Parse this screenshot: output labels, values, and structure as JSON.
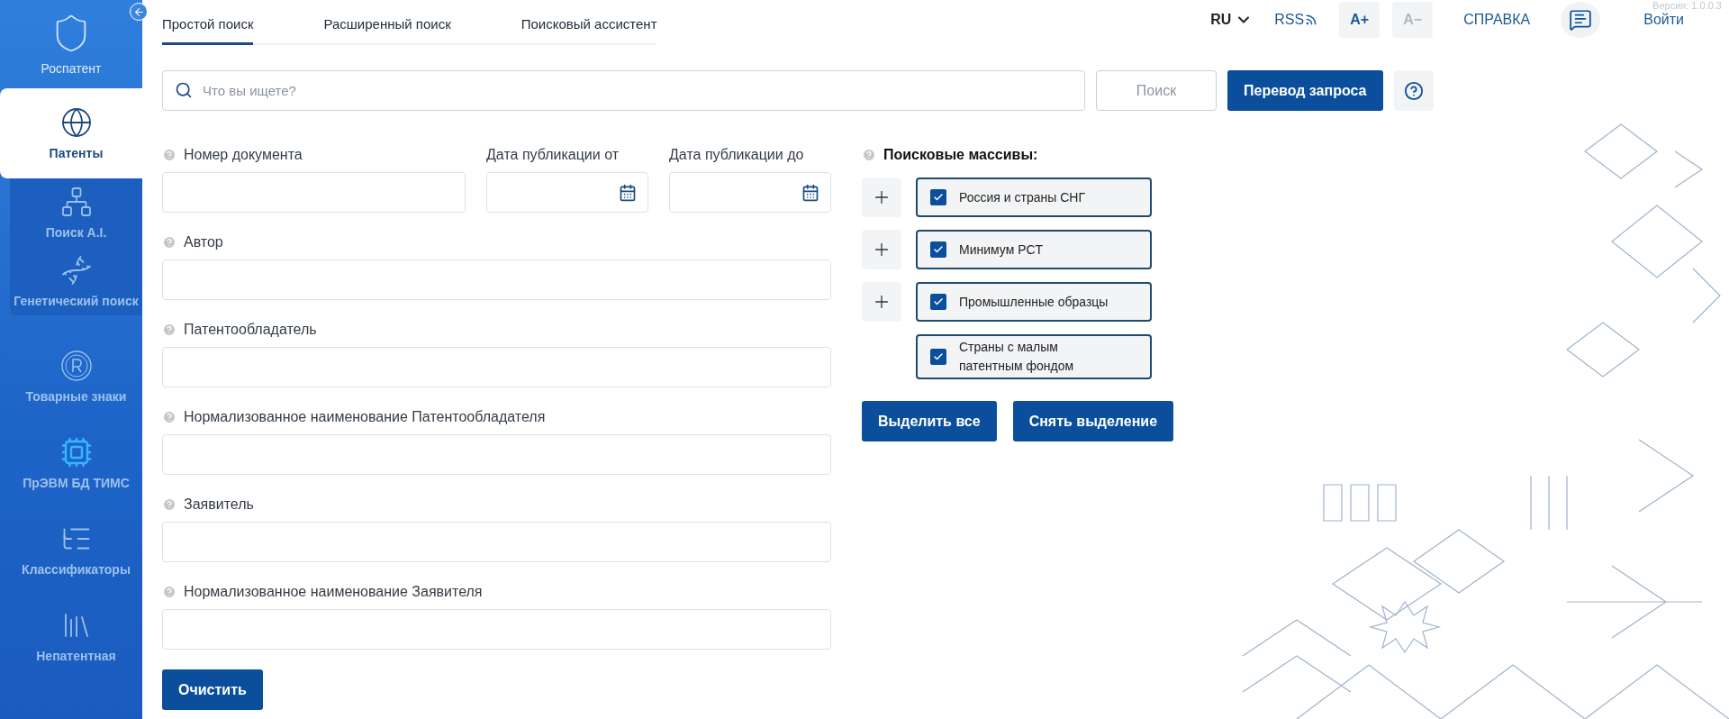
{
  "sidebar": {
    "brand": "Роспатент",
    "sections": [
      {
        "kind": "panel",
        "items": [
          {
            "label": "Патенты",
            "selected": true
          },
          {
            "label": "Поиск A.I.",
            "selected": false
          },
          {
            "label": "Генетический поиск",
            "selected": false
          }
        ]
      },
      {
        "kind": "plain",
        "items": [
          {
            "label": "Товарные знаки",
            "selected": false
          },
          {
            "label": "ПрЭВМ БД ТИМС",
            "selected": false
          },
          {
            "label": "Классификаторы",
            "selected": false
          },
          {
            "label": "Непатентная",
            "selected": false
          }
        ]
      }
    ]
  },
  "tabs": [
    {
      "label": "Простой поиск",
      "selected": true
    },
    {
      "label": "Расширенный поиск",
      "selected": false
    },
    {
      "label": "Поисковый ассистент",
      "selected": false
    }
  ],
  "header": {
    "language": "RU",
    "rss": "RSS",
    "font_buttons": [
      {
        "label": "A+",
        "disabled": false
      },
      {
        "label": "A−",
        "disabled": true
      }
    ],
    "help": "СПРАВКА",
    "login": "Войти",
    "version": "Версия: 1.0.0.3"
  },
  "search": {
    "placeholder": "Что вы ищете?",
    "search_button": "Поиск",
    "translate_button": "Перевод запроса"
  },
  "form": {
    "rows": [
      [
        {
          "label": "Номер документа",
          "help": true,
          "kind": "text"
        },
        {
          "label": "Дата публикации от",
          "help": false,
          "kind": "date"
        },
        {
          "label": "Дата публикации до",
          "help": false,
          "kind": "date"
        }
      ],
      [
        {
          "label": "Автор",
          "help": true,
          "kind": "text"
        }
      ],
      [
        {
          "label": "Патентообладатель",
          "help": true,
          "kind": "text"
        }
      ],
      [
        {
          "label": "Нормализованное наименование Патентообладателя",
          "help": true,
          "kind": "text"
        }
      ],
      [
        {
          "label": "Заявитель",
          "help": true,
          "kind": "text"
        }
      ],
      [
        {
          "label": "Нормализованное наименование Заявителя",
          "help": true,
          "kind": "text"
        }
      ]
    ],
    "clear_button": "Очистить"
  },
  "arrays": {
    "title": "Поисковые массивы:",
    "items": [
      {
        "label": "Россия и страны СНГ",
        "checked": true,
        "expandable": true
      },
      {
        "label": "Минимум PCT",
        "checked": true,
        "expandable": true
      },
      {
        "label": "Промышленные образцы",
        "checked": true,
        "expandable": true
      },
      {
        "label": "Страны с малым патентным фондом",
        "checked": true,
        "expandable": false
      }
    ],
    "select_all": "Выделить все",
    "deselect": "Снять выделение"
  }
}
